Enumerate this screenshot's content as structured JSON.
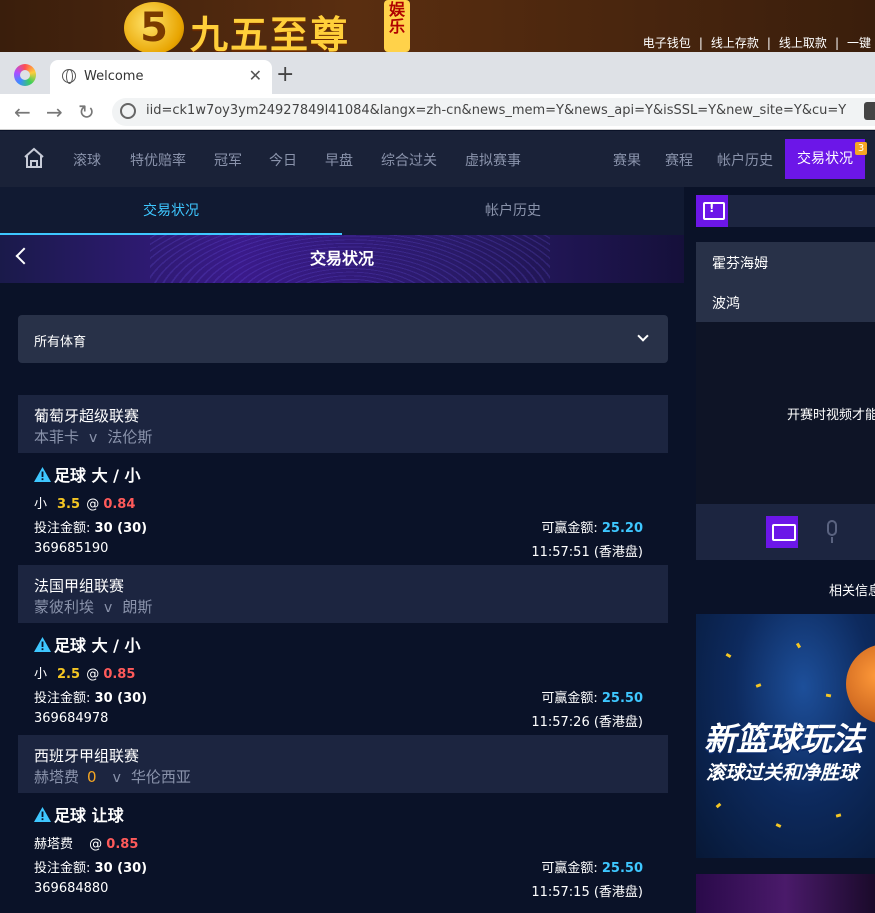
{
  "banner": {
    "logo_digit": "5",
    "logo_text": "九五至尊",
    "logo_badge": "娱乐",
    "links": [
      "电子钱包",
      "|",
      "线上存款",
      "|",
      "线上取款",
      "|",
      "一键"
    ]
  },
  "browser": {
    "tab_title": "Welcome",
    "url": "iid=ck1w7oy3ym24927849l41084&langx=zh-cn&news_mem=Y&news_api=Y&isSSL=Y&new_site=Y&cu=Y"
  },
  "nav": {
    "items": [
      "滚球",
      "特优赔率",
      "冠军",
      "今日",
      "早盘",
      "综合过关",
      "虚拟赛事",
      "赛果",
      "赛程",
      "帐户历史"
    ],
    "active": "交易状况",
    "badge": "3"
  },
  "subtabs": [
    "交易状况",
    "帐户历史"
  ],
  "header": {
    "title": "交易状况"
  },
  "filter": {
    "label": "所有体育"
  },
  "bets": [
    {
      "league": "葡萄牙超级联赛",
      "home": "本菲卡",
      "vs": "v",
      "away": "法伦斯",
      "score": "",
      "bet_type": "足球 大 / 小",
      "selection": "小",
      "handicap": "3.5",
      "at": "@",
      "odds": "0.84",
      "stake_label": "投注金额:",
      "stake": "30 (30)",
      "win_label": "可赢金额:",
      "win": "25.20",
      "ref": "369685190",
      "time": "11:57:51 (香港盘)"
    },
    {
      "league": "法国甲组联赛",
      "home": "蒙彼利埃",
      "vs": "v",
      "away": "朗斯",
      "score": "",
      "bet_type": "足球 大 / 小",
      "selection": "小",
      "handicap": "2.5",
      "at": "@",
      "odds": "0.85",
      "stake_label": "投注金额:",
      "stake": "30 (30)",
      "win_label": "可赢金额:",
      "win": "25.50",
      "ref": "369684978",
      "time": "11:57:26 (香港盘)"
    },
    {
      "league": "西班牙甲组联赛",
      "home": "赫塔费",
      "vs": "v",
      "away": "华伦西亚",
      "score": "0",
      "bet_type": "足球 让球",
      "selection": "赫塔费",
      "handicap": "",
      "at": "@",
      "odds": "0.85",
      "stake_label": "投注金额:",
      "stake": "30 (30)",
      "win_label": "可赢金额:",
      "win": "25.50",
      "ref": "369684880",
      "time": "11:57:15 (香港盘)"
    }
  ],
  "right": {
    "teams": [
      "霍芬海姆",
      "波鸿"
    ],
    "video_msg": "开赛时视频才能",
    "related": "相关信息",
    "promo_title": "新篮球玩法",
    "promo_sub": "滚球过关和净胜球"
  },
  "colors": {
    "accent_purple": "#6c16e8",
    "accent_cyan": "#3ec7ff",
    "odds_red": "#ff5a5a",
    "handicap_yellow": "#f5c623"
  }
}
